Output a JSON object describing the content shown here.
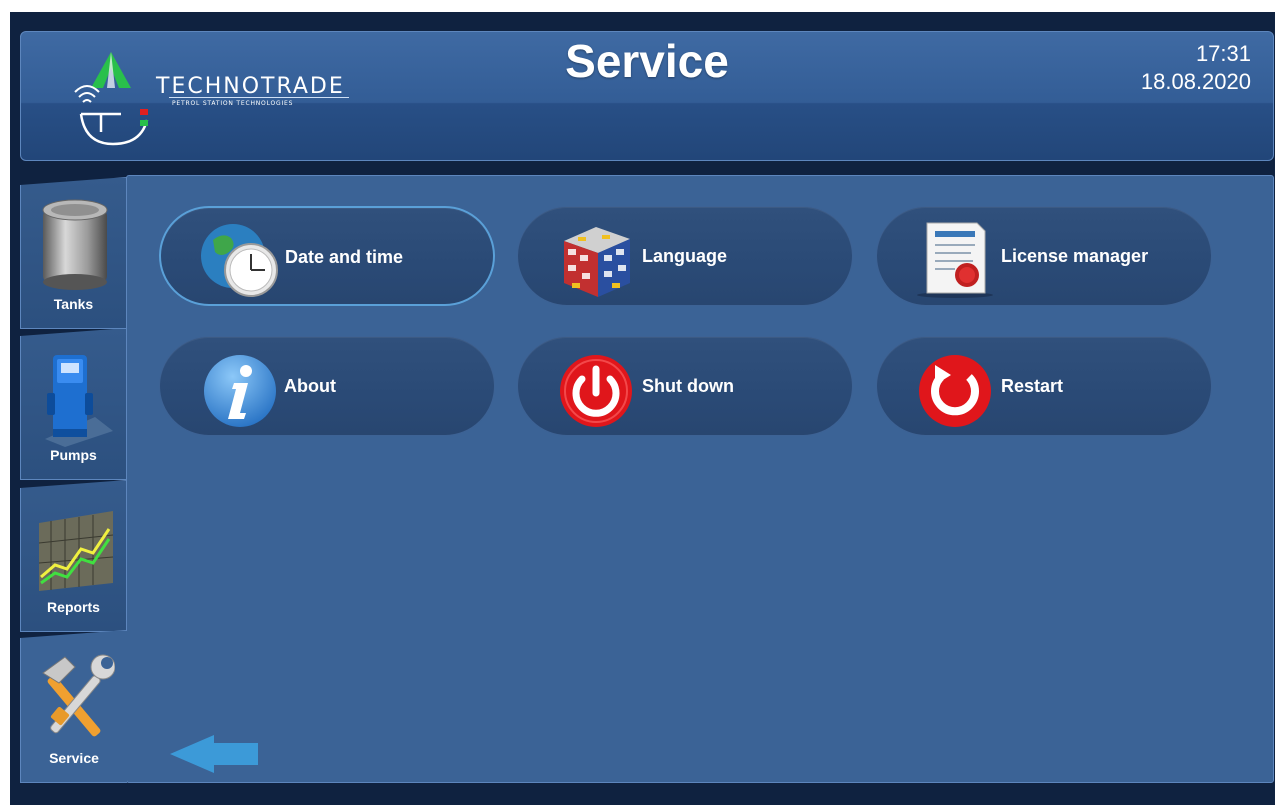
{
  "header": {
    "logo_text": "TECHNOTRADE",
    "logo_subtitle": "PETROL STATION TECHNOLOGIES",
    "title": "Service",
    "time": "17:31",
    "date": "18.08.2020"
  },
  "sidebar": {
    "items": [
      {
        "label": "Tanks",
        "icon": "tank-icon"
      },
      {
        "label": "Pumps",
        "icon": "fuel-pump-icon"
      },
      {
        "label": "Reports",
        "icon": "chart-icon"
      },
      {
        "label": "Service",
        "icon": "tools-icon",
        "active": true
      }
    ]
  },
  "service": {
    "buttons": [
      {
        "label": "Date and time",
        "icon": "globe-clock-icon",
        "selected": true
      },
      {
        "label": "Language",
        "icon": "flags-cube-icon"
      },
      {
        "label": "License manager",
        "icon": "certificate-icon"
      },
      {
        "label": "About",
        "icon": "info-icon"
      },
      {
        "label": "Shut down",
        "icon": "power-icon"
      },
      {
        "label": "Restart",
        "icon": "restart-icon"
      }
    ]
  },
  "colors": {
    "panel": "#3b6396",
    "header": "#335d96",
    "button": "#2c4c78",
    "accent": "#5aa0d8",
    "power_red": "#e0161b"
  }
}
